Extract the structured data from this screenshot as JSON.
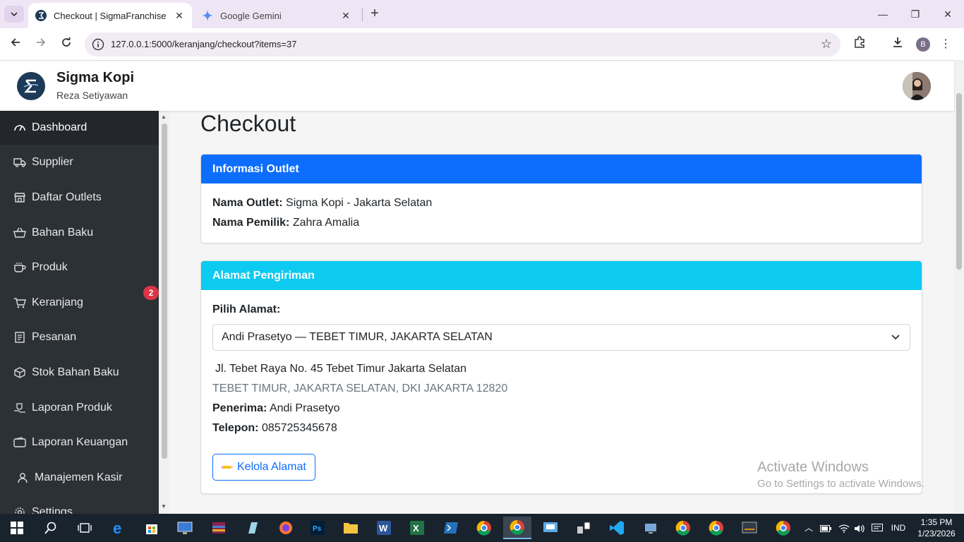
{
  "browser": {
    "tabs": [
      {
        "title": "Checkout | SigmaFranchise",
        "active": true
      },
      {
        "title": "Google Gemini",
        "active": false
      }
    ],
    "url": "127.0.0.1:5000/keranjang/checkout?items=37",
    "profile_initial": "B"
  },
  "header": {
    "brand": "Sigma Kopi",
    "user": "Reza Setiyawan"
  },
  "sidebar": {
    "items": [
      {
        "label": "Dashboard",
        "icon": "gauge-icon"
      },
      {
        "label": "Supplier",
        "icon": "truck-icon"
      },
      {
        "label": "Daftar Outlets",
        "icon": "store-icon"
      },
      {
        "label": "Bahan Baku",
        "icon": "basket-icon"
      },
      {
        "label": "Produk",
        "icon": "cup-icon"
      },
      {
        "label": "Keranjang",
        "icon": "cart-icon"
      },
      {
        "label": "Pesanan",
        "icon": "receipt-icon"
      },
      {
        "label": "Stok Bahan Baku",
        "icon": "box-icon"
      },
      {
        "label": "Laporan Produk",
        "icon": "hand-cup-icon"
      },
      {
        "label": "Laporan Keuangan",
        "icon": "wallet-icon"
      },
      {
        "label": "Manajemen Kasir",
        "icon": "user-icon"
      },
      {
        "label": "Settings",
        "icon": "gear-icon"
      }
    ],
    "cart_badge": "2"
  },
  "main": {
    "title": "Checkout",
    "outlet_card": {
      "header": "Informasi Outlet",
      "name_label": "Nama Outlet:",
      "name_value": "Sigma Kopi - Jakarta Selatan",
      "owner_label": "Nama Pemilik:",
      "owner_value": "Zahra Amalia",
      "header_color": "#0d6efd"
    },
    "address_card": {
      "header": "Alamat Pengiriman",
      "header_color": "#0dcaf0",
      "select_label": "Pilih Alamat:",
      "selected_address": "Andi Prasetyo — TEBET TIMUR, JAKARTA SELATAN",
      "street": "Jl. Tebet Raya No. 45 Tebet Timur Jakarta Selatan",
      "region": "TEBET TIMUR, JAKARTA SELATAN, DKI JAKARTA 12820",
      "recipient_label": "Penerima:",
      "recipient_value": "Andi Prasetyo",
      "phone_label": "Telepon:",
      "phone_value": "085725345678",
      "manage_button": "Kelola Alamat"
    }
  },
  "watermark": {
    "line1": "Activate Windows",
    "line2": "Go to Settings to activate Windows."
  },
  "taskbar": {
    "language": "IND",
    "time": "1:35 PM",
    "date": "1/23/2026"
  }
}
